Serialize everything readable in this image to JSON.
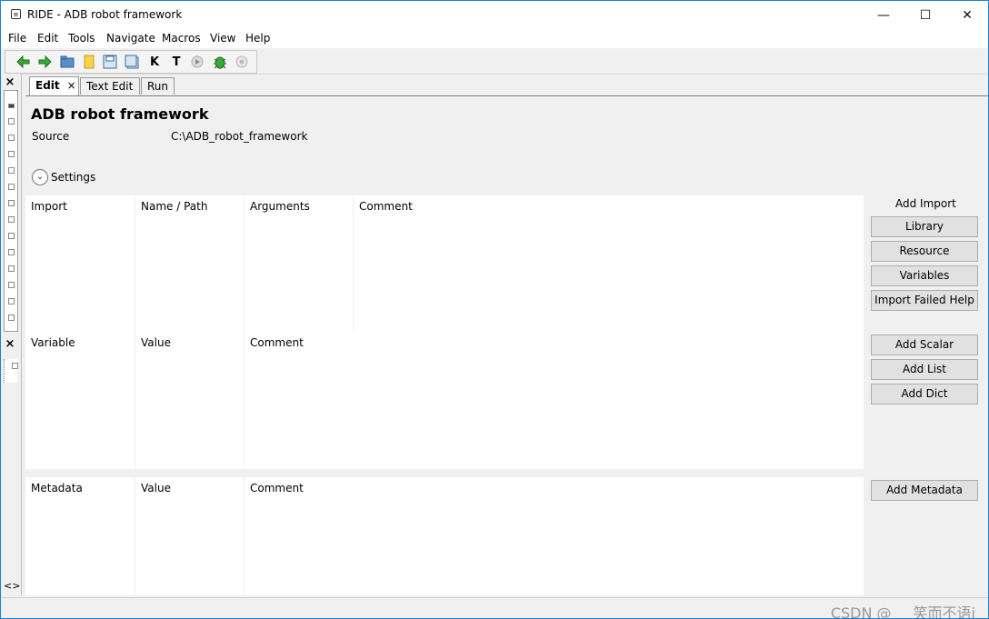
{
  "window": {
    "title": "RIDE - ADB robot framework",
    "app_icon": "ride-icon",
    "controls": {
      "minimize": "—",
      "maximize": "☐",
      "close": "✕"
    }
  },
  "menu": [
    "File",
    "Edit",
    "Tools",
    "Navigate",
    "Macros",
    "View",
    "Help"
  ],
  "toolbar": {
    "icons": [
      "back-arrow-icon",
      "forward-arrow-icon",
      "open-folder-icon",
      "new-file-icon",
      "save-icon",
      "save-all-icon",
      "search-keywords-icon",
      "search-tests-icon",
      "run-icon",
      "debug-bug-icon",
      "stop-icon"
    ],
    "search_k": "K",
    "search_t": "T"
  },
  "left_pane": {
    "close": "×",
    "close2": "×",
    "arrows": "<>"
  },
  "tabs": [
    {
      "label": "Edit",
      "active": true
    },
    {
      "label": "Text Edit",
      "active": false
    },
    {
      "label": "Run",
      "active": false
    }
  ],
  "tab_close": "×",
  "editor": {
    "title": "ADB robot framework",
    "source_label": "Source",
    "source_value": "C:\\ADB_robot_framework",
    "settings_label": "Settings",
    "settings_icon": "⌄"
  },
  "import_table": {
    "headers": [
      "Import",
      "Name / Path",
      "Arguments",
      "Comment"
    ],
    "side_title": "Add Import",
    "buttons": [
      "Library",
      "Resource",
      "Variables",
      "Import Failed Help"
    ]
  },
  "variable_table": {
    "headers": [
      "Variable",
      "Value",
      "Comment"
    ],
    "buttons": [
      "Add Scalar",
      "Add List",
      "Add Dict"
    ]
  },
  "metadata_table": {
    "headers": [
      "Metadata",
      "Value",
      "Comment"
    ],
    "buttons": [
      "Add Metadata"
    ]
  },
  "watermark": "CSDN @___笑而不语i",
  "colors": {
    "border": "#1883d7",
    "background": "#f0f0f0",
    "grid": "#ffffff"
  }
}
